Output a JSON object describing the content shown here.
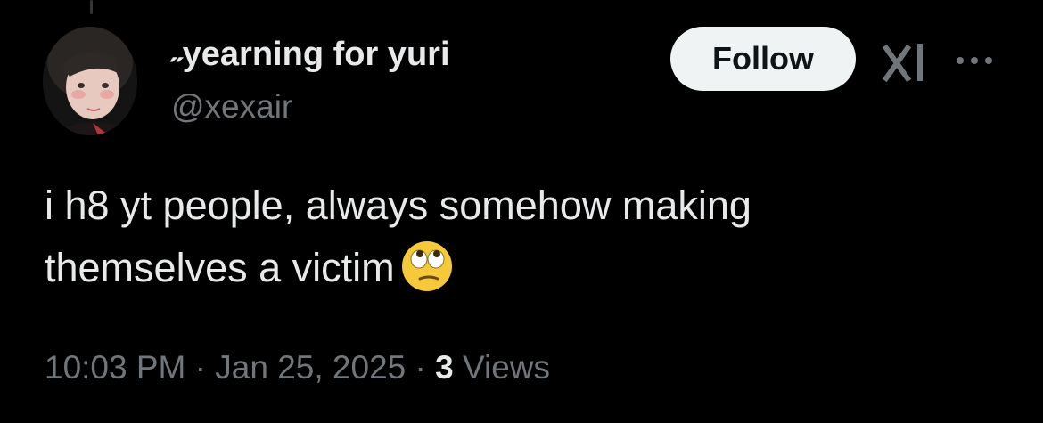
{
  "tweet": {
    "author": {
      "display_name": "˶yearning for yuri",
      "handle": "@xexair",
      "avatar_icon": "profile-photo"
    },
    "follow_label": "Follow",
    "text_line1": "i h8 yt people, always somehow making",
    "text_line2": "themselves a victim",
    "emoji": "face-with-rolling-eyes",
    "time": "10:03 PM",
    "separator": " · ",
    "date": "Jan 25, 2025",
    "views_count": "3",
    "views_label": " Views"
  },
  "icons": {
    "grok": "grok-icon",
    "more": "more-icon"
  },
  "colors": {
    "background": "#000000",
    "primary_text": "#e7e9ea",
    "secondary_text": "#71767b",
    "follow_button_bg": "#eff3f4",
    "follow_button_text": "#0f1419"
  }
}
